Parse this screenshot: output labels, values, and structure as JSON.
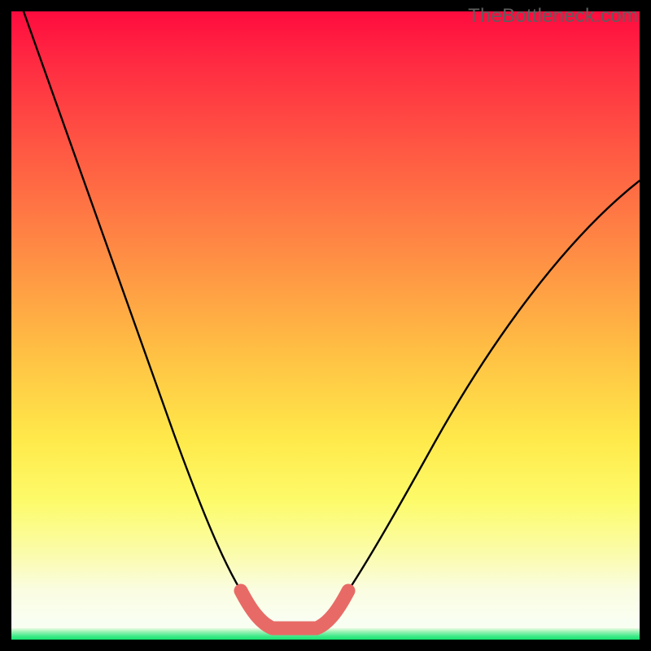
{
  "watermark": "TheBottleneck.com",
  "chart_data": {
    "type": "line",
    "title": "",
    "xlabel": "",
    "ylabel": "",
    "xlim": [
      0,
      100
    ],
    "ylim": [
      0,
      100
    ],
    "grid": false,
    "legend": false,
    "series": [
      {
        "name": "bottleneck-curve",
        "color": "#000000",
        "x": [
          2,
          10,
          18,
          26,
          32,
          36.5,
          39.5,
          41.5,
          48.5,
          50.5,
          53.5,
          58,
          64,
          72,
          82,
          92,
          100
        ],
        "values": [
          100,
          78,
          56,
          34,
          18,
          7,
          2.8,
          1.8,
          1.8,
          2.8,
          7,
          18,
          31,
          44,
          57,
          67,
          73
        ]
      },
      {
        "name": "valley-highlight",
        "color": "#e86a66",
        "x": [
          36.5,
          39.5,
          41.5,
          48.5,
          50.5,
          53.5
        ],
        "values": [
          7,
          2.8,
          1.8,
          1.8,
          2.8,
          7
        ]
      }
    ],
    "annotations": []
  },
  "colors": {
    "curve": "#000000",
    "valley_highlight": "#e86a66",
    "watermark": "#5e5e5e"
  }
}
